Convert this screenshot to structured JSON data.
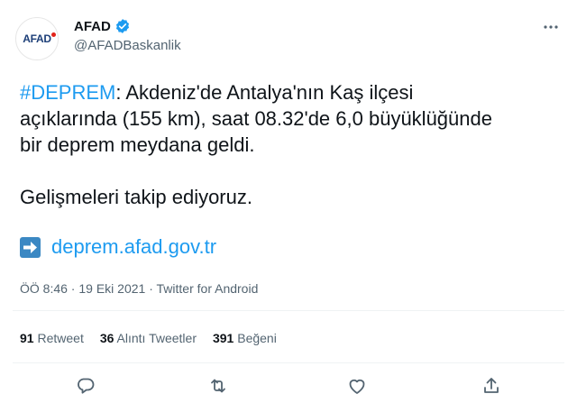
{
  "author": {
    "avatar_text": "AFAD",
    "name": "AFAD",
    "handle": "@AFADBaskanlik",
    "verified": true
  },
  "tweet": {
    "hashtag": "#DEPREM",
    "line1_rest": ": Akdeniz'de Antalya'nın Kaş ilçesi",
    "line2": "açıklarında (155 km), saat 08.32'de 6,0 büyüklüğünde",
    "line3": "bir deprem meydana geldi.",
    "line4": "Gelişmeleri takip ediyoruz.",
    "link_icon": "right-arrow-emoji-icon",
    "link": "deprem.afad.gov.tr"
  },
  "meta": {
    "time": "ÖÖ 8:46",
    "sep1": " · ",
    "date": "19 Eki 2021",
    "sep2": " · ",
    "source": "Twitter for Android"
  },
  "stats": {
    "retweets_count": "91",
    "retweets_label": "Retweet",
    "quotes_count": "36",
    "quotes_label": "Alıntı Tweetler",
    "likes_count": "391",
    "likes_label": "Beğeni"
  },
  "actions": [
    "reply-icon",
    "retweet-icon",
    "like-icon",
    "share-icon"
  ],
  "colors": {
    "accent": "#1d9bf0",
    "text": "#0f1419",
    "secondary": "#536471",
    "divider": "#eff3f4",
    "link_icon_bg": "#3b88c3"
  }
}
